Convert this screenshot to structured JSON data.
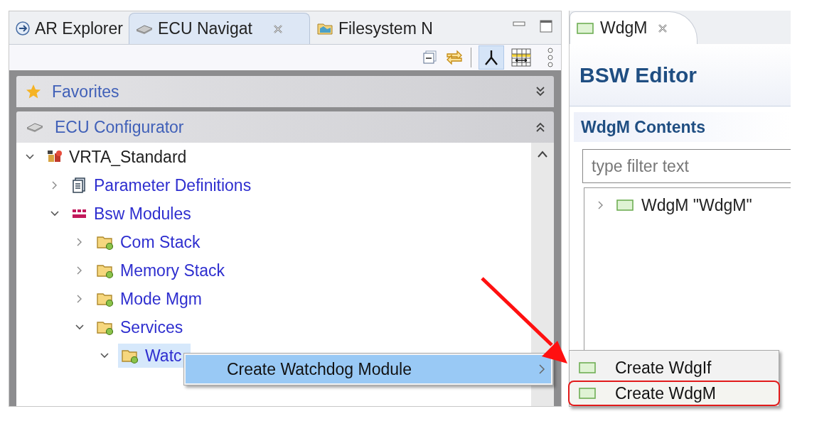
{
  "navigator": {
    "tabs": [
      {
        "label": "AR Explorer",
        "kind": "explorer",
        "selected": false
      },
      {
        "label": "ECU Navigat",
        "kind": "ecu",
        "selected": true
      },
      {
        "label": "Filesystem N",
        "kind": "filesystem",
        "selected": false
      }
    ],
    "sections": [
      {
        "title": "Favorites",
        "kind": "favorites",
        "expanded": false
      },
      {
        "title": "ECU Configurator",
        "kind": "ecu",
        "expanded": true
      }
    ],
    "tree": [
      {
        "label": "VRTA_Standard",
        "kind": "project",
        "expanded": true,
        "selected": false,
        "children": [
          {
            "label": "Parameter Definitions",
            "kind": "document",
            "expanded": false,
            "selected": false
          },
          {
            "label": "Bsw Modules",
            "kind": "modules",
            "expanded": true,
            "selected": false,
            "children": [
              {
                "label": "Com Stack",
                "kind": "folder",
                "expanded": false,
                "selected": false
              },
              {
                "label": "Memory Stack",
                "kind": "folder",
                "expanded": false,
                "selected": false
              },
              {
                "label": "Mode Mgm",
                "kind": "folder",
                "expanded": false,
                "selected": false
              },
              {
                "label": "Services",
                "kind": "folder",
                "expanded": true,
                "selected": false,
                "children": [
                  {
                    "label": "Watc",
                    "kind": "folder",
                    "expanded": true,
                    "selected": true
                  }
                ]
              }
            ]
          }
        ]
      }
    ]
  },
  "editor": {
    "tab": "WdgM",
    "title": "BSW Editor",
    "section": "WdgM Contents",
    "filter": {
      "placeholder": "type filter text"
    },
    "tree": [
      {
        "label": "WdgM \"WdgM\"",
        "kind": "module",
        "expanded": false,
        "selected": false
      }
    ]
  },
  "context_menu": {
    "items": [
      {
        "label": "Create Watchdog Module",
        "selected": true
      }
    ]
  },
  "submenu": {
    "items": [
      {
        "label": "Create WdgIf",
        "selected": false
      },
      {
        "label": "Create WdgM",
        "selected": true
      }
    ]
  }
}
